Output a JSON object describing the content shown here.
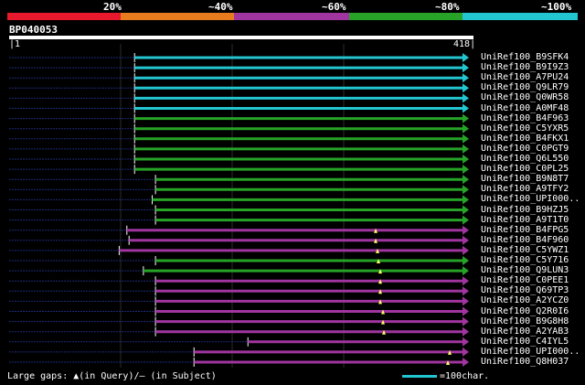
{
  "legend": {
    "ticks": [
      "20%",
      "~40%",
      "~60%",
      "~80%",
      "~100%"
    ],
    "segments": [
      {
        "color": "#e8192c"
      },
      {
        "color": "#e87b1e"
      },
      {
        "color": "#a035a0"
      },
      {
        "color": "#27a327"
      },
      {
        "color": "#22c5d0"
      }
    ]
  },
  "query": {
    "id": "BP040053",
    "start": "1",
    "end": "418",
    "length": 418
  },
  "hits": [
    {
      "name": "UniRef100_B9SFK4",
      "color": "#22c5d0",
      "from": 1,
      "to": 418,
      "dotted_to": 115,
      "markers": []
    },
    {
      "name": "UniRef100_B9I9Z3",
      "color": "#22c5d0",
      "from": 1,
      "to": 418,
      "dotted_to": 115,
      "markers": []
    },
    {
      "name": "UniRef100_A7PU24",
      "color": "#22c5d0",
      "from": 1,
      "to": 418,
      "dotted_to": 115,
      "markers": []
    },
    {
      "name": "UniRef100_Q9LR79",
      "color": "#22c5d0",
      "from": 1,
      "to": 418,
      "dotted_to": 115,
      "markers": []
    },
    {
      "name": "UniRef100_Q0WR58",
      "color": "#22c5d0",
      "from": 1,
      "to": 418,
      "dotted_to": 115,
      "markers": []
    },
    {
      "name": "UniRef100_A0MF48",
      "color": "#22c5d0",
      "from": 1,
      "to": 418,
      "dotted_to": 115,
      "markers": []
    },
    {
      "name": "UniRef100_B4F963",
      "color": "#27a327",
      "from": 1,
      "to": 418,
      "dotted_to": 115,
      "markers": []
    },
    {
      "name": "UniRef100_C5YXR5",
      "color": "#27a327",
      "from": 1,
      "to": 418,
      "dotted_to": 115,
      "markers": []
    },
    {
      "name": "UniRef100_B4FKX1",
      "color": "#27a327",
      "from": 1,
      "to": 418,
      "dotted_to": 115,
      "markers": []
    },
    {
      "name": "UniRef100_C0PGT9",
      "color": "#27a327",
      "from": 1,
      "to": 418,
      "dotted_to": 115,
      "markers": []
    },
    {
      "name": "UniRef100_Q6L550",
      "color": "#27a327",
      "from": 1,
      "to": 418,
      "dotted_to": 115,
      "markers": []
    },
    {
      "name": "UniRef100_C0PL25",
      "color": "#27a327",
      "from": 1,
      "to": 418,
      "dotted_to": 115,
      "markers": []
    },
    {
      "name": "UniRef100_B9N8T7",
      "color": "#27a327",
      "from": 1,
      "to": 418,
      "dotted_to": 134,
      "markers": []
    },
    {
      "name": "UniRef100_A9TFY2",
      "color": "#27a327",
      "from": 1,
      "to": 418,
      "dotted_to": 134,
      "markers": []
    },
    {
      "name": "UniRef100_UPI000..",
      "color": "#27a327",
      "from": 1,
      "to": 418,
      "dotted_to": 131,
      "markers": []
    },
    {
      "name": "UniRef100_B9HZJ5",
      "color": "#27a327",
      "from": 1,
      "to": 418,
      "dotted_to": 134,
      "markers": []
    },
    {
      "name": "UniRef100_A9T1T0",
      "color": "#27a327",
      "from": 1,
      "to": 418,
      "dotted_to": 134,
      "markers": []
    },
    {
      "name": "UniRef100_B4FPG5",
      "color": "#a035a0",
      "from": 1,
      "to": 418,
      "dotted_to": 108,
      "markers": [
        411
      ]
    },
    {
      "name": "UniRef100_B4F960",
      "color": "#a035a0",
      "from": 1,
      "to": 418,
      "dotted_to": 110,
      "markers": [
        411
      ]
    },
    {
      "name": "UniRef100_C5YWZ1",
      "color": "#a035a0",
      "from": 1,
      "to": 418,
      "dotted_to": 101,
      "markers": [
        413
      ]
    },
    {
      "name": "UniRef100_C5Y716",
      "color": "#27a327",
      "from": 1,
      "to": 418,
      "dotted_to": 134,
      "markers": [
        414
      ]
    },
    {
      "name": "UniRef100_Q9LUN3",
      "color": "#27a327",
      "from": 1,
      "to": 418,
      "dotted_to": 123,
      "markers": [
        416
      ]
    },
    {
      "name": "UniRef100_C0PEE1",
      "color": "#a035a0",
      "from": 1,
      "to": 418,
      "dotted_to": 134,
      "markers": [
        416
      ]
    },
    {
      "name": "UniRef100_Q69TP3",
      "color": "#a035a0",
      "from": 1,
      "to": 418,
      "dotted_to": 134,
      "markers": [
        416
      ]
    },
    {
      "name": "UniRef100_A2YCZ0",
      "color": "#a035a0",
      "from": 1,
      "to": 418,
      "dotted_to": 134,
      "markers": [
        416
      ]
    },
    {
      "name": "UniRef100_Q2R0I6",
      "color": "#a035a0",
      "from": 1,
      "to": 418,
      "dotted_to": 134,
      "markers": [
        419
      ]
    },
    {
      "name": "UniRef100_B9G8H8",
      "color": "#a035a0",
      "from": 1,
      "to": 418,
      "dotted_to": 134,
      "markers": [
        419
      ]
    },
    {
      "name": "UniRef100_A2YAB3",
      "color": "#a035a0",
      "from": 1,
      "to": 418,
      "dotted_to": 134,
      "markers": [
        420
      ]
    },
    {
      "name": "UniRef100_C4IYL5",
      "color": "#a035a0",
      "from": 1,
      "to": 418,
      "dotted_to": 218,
      "markers": []
    },
    {
      "name": "UniRef100_UPI000..",
      "color": "#a035a0",
      "from": 1,
      "to": 418,
      "dotted_to": 169,
      "markers": [
        492
      ]
    },
    {
      "name": "UniRef100_Q8H037",
      "color": "#a035a0",
      "from": 1,
      "to": 418,
      "dotted_to": 169,
      "markers": [
        490
      ]
    }
  ],
  "footer": {
    "text": "Large gaps: ▲(in Query)/– (in Subject)"
  },
  "scale": {
    "text": "=100char."
  }
}
